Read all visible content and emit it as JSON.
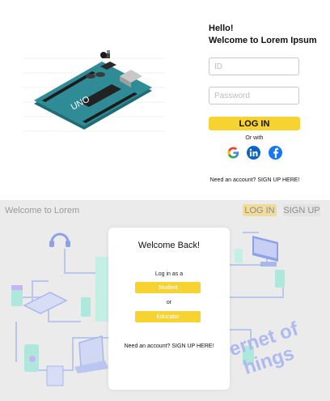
{
  "login_panel": {
    "greeting_line1": "Hello!",
    "greeting_line2": "Welcome to Lorem Ipsum",
    "hero_image": "arduino-uno-board-illustration",
    "id_placeholder": "ID",
    "password_placeholder": "Password",
    "login_button": "LOG IN",
    "or_with": "Or with",
    "social_icons": [
      "google-icon",
      "linkedin-icon",
      "facebook-icon"
    ],
    "signup_prompt": "Need an account?",
    "signup_link": "SIGN UP HERE!",
    "board_label": "UNO"
  },
  "landing": {
    "brand": "Welcome to Lorem",
    "nav_login": "LOG IN",
    "nav_signup": "SIGN UP",
    "card": {
      "title": "Welcome Back!",
      "login_as": "Log in as a",
      "student_button": "Student",
      "or": "or",
      "educator_button": "Educator",
      "signup_prompt": "Need an account?",
      "signup_link": "SIGN UP HERE!"
    },
    "background_text_line1": "ernet of",
    "background_text_line2": "hings"
  },
  "colors": {
    "accent_yellow": "#f7d332",
    "muted_yellow": "#f0dd9c",
    "board_teal": "#2f8c96",
    "iot_blue": "#a9b7ef",
    "iot_line": "#b9c6ee",
    "bottom_bg": "#ebebeb"
  }
}
